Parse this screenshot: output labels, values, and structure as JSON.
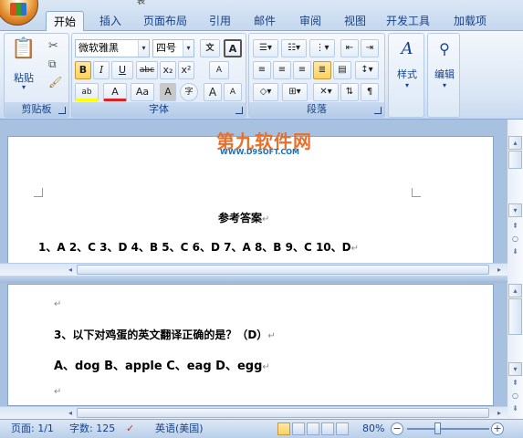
{
  "tabs": [
    "开始",
    "插入",
    "页面布局",
    "引用",
    "邮件",
    "审阅",
    "视图",
    "开发工具",
    "加载项"
  ],
  "active_tab": "开始",
  "quick_access_text": "表",
  "clipboard": {
    "paste_label": "粘贴",
    "group_label": "剪贴板"
  },
  "font": {
    "font_name": "微软雅黑",
    "font_size": "四号",
    "group_label": "字体",
    "btn_bold": "B",
    "btn_italic": "I",
    "btn_underline": "U",
    "btn_strike": "abc",
    "btn_sub": "x₂",
    "btn_sup": "x²",
    "btn_grow": "A",
    "btn_shrink": "A",
    "btn_aa": "Aa",
    "btn_char_border": "A",
    "btn_enclose": "字",
    "btn_wen": "文",
    "btn_clear": "A",
    "btn_color": "A",
    "btn_highlight": "ab"
  },
  "paragraph": {
    "group_label": "段落"
  },
  "styles": {
    "label": "样式"
  },
  "editing": {
    "label": "编辑"
  },
  "watermark": {
    "main": "第九软件网",
    "sub": "WWW.D9SOFT.COM"
  },
  "page1": {
    "title": "参考答案",
    "answers": "1、A   2、C   3、D   4、B   5、C   6、D   7、A   8、B   9、C   10、D"
  },
  "page2": {
    "question": "3、以下对鸡蛋的英文翻译正确的是？（D）",
    "options": "A、dog   B、apple   C、eag   D、egg"
  },
  "paragraph_mark": "↵",
  "status": {
    "page": "页面: 1/1",
    "words": "字数: 125",
    "language": "英语(美国)",
    "zoom": "80%",
    "zoom_level": 0.8
  },
  "colors": {
    "ribbon_text": "#15428b",
    "highlight": "#ffd15c",
    "watermark_orange": "#e8702a",
    "watermark_blue": "#1e6fb8"
  }
}
